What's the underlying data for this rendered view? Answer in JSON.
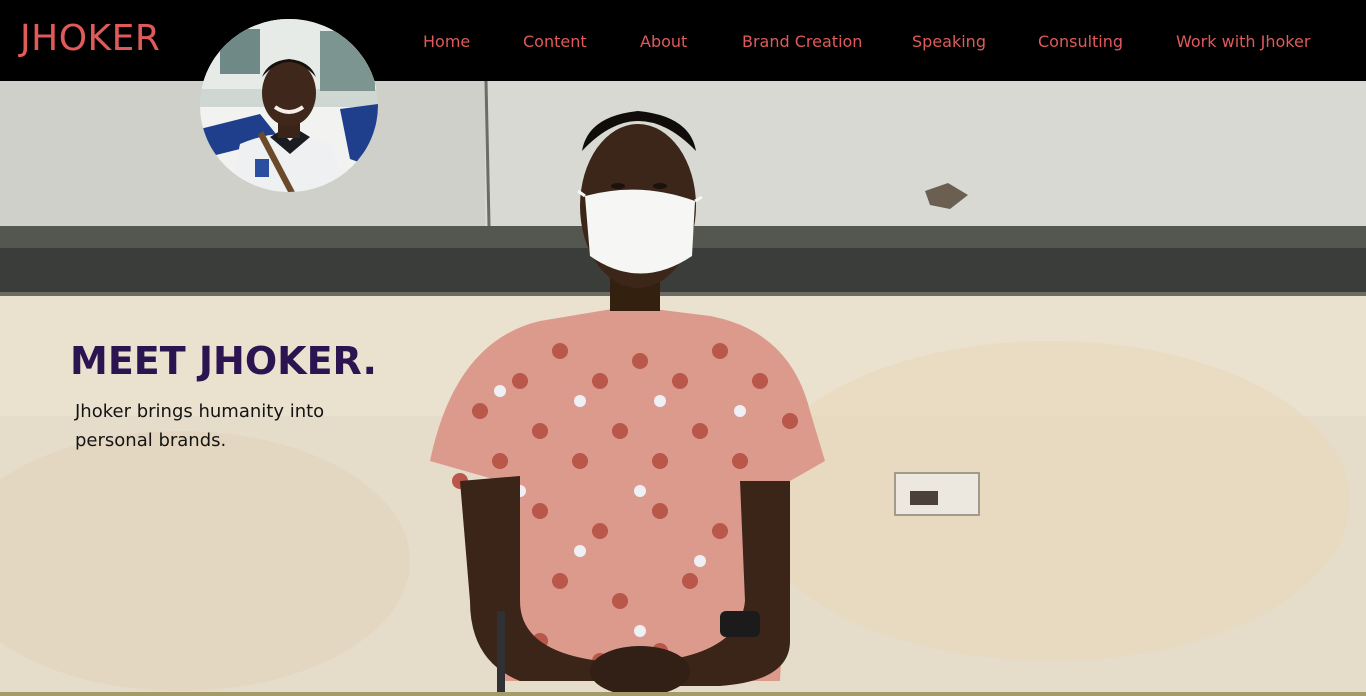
{
  "header": {
    "logo": "JHOKER",
    "nav": [
      {
        "label": "Home"
      },
      {
        "label": "Content"
      },
      {
        "label": "About"
      },
      {
        "label": "Brand Creation"
      },
      {
        "label": "Speaking"
      },
      {
        "label": "Consulting"
      },
      {
        "label": "Work with Jhoker"
      }
    ]
  },
  "hero": {
    "title": "MEET JHOKER.",
    "subtitle": "Jhoker brings humanity into personal brands."
  },
  "colors": {
    "header_bg": "#000000",
    "accent": "#e05a5a",
    "title": "#2c1450"
  },
  "images": {
    "avatar": "avatar-photo",
    "hero": "hero-photo"
  }
}
